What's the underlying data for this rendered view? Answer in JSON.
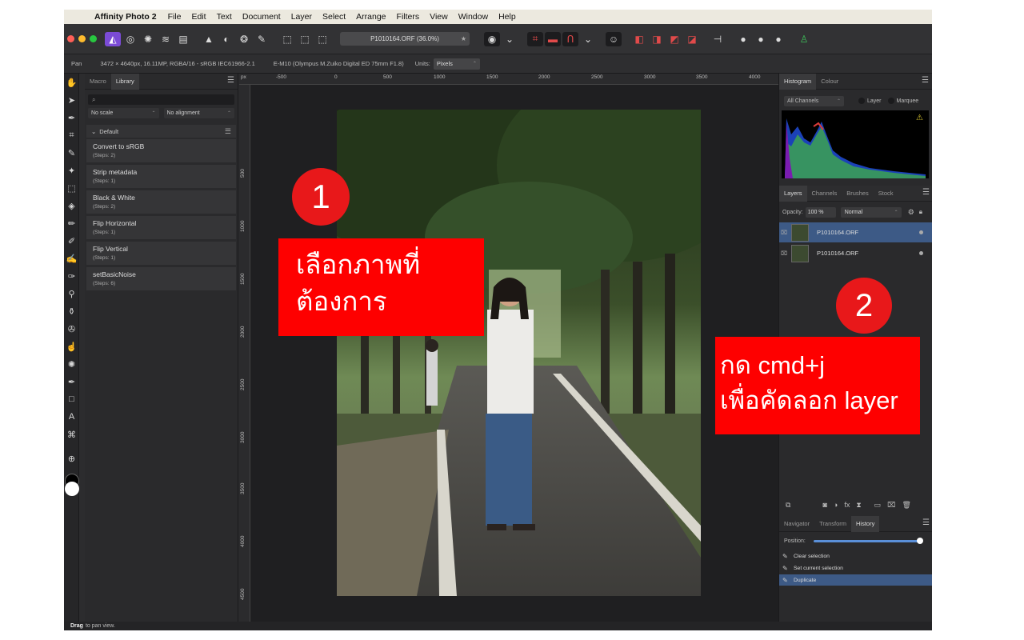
{
  "menubar": {
    "app_name": "Affinity Photo 2",
    "items": [
      "File",
      "Edit",
      "Text",
      "Document",
      "Layer",
      "Select",
      "Arrange",
      "Filters",
      "View",
      "Window",
      "Help"
    ]
  },
  "toolbar": {
    "document_title": "P1010164.ORF (36.0%)"
  },
  "context_bar": {
    "tool": "Pan",
    "image_info": "3472 × 4640px, 16.11MP, RGBA/16 - sRGB IEC61966-2.1",
    "lens_info": "E-M10 (Olympus M.Zuiko Digital ED 75mm F1.8)",
    "units_label": "Units:",
    "units_value": "Pixels"
  },
  "library_panel": {
    "tabs": [
      "Macro",
      "Library"
    ],
    "active_tab": "Library",
    "scale_select": "No scale",
    "alignment_select": "No alignment",
    "group_name": "Default",
    "macros": [
      {
        "name": "Convert to sRGB",
        "steps": "(Steps: 2)"
      },
      {
        "name": "Strip metadata",
        "steps": "(Steps: 1)"
      },
      {
        "name": "Black & White",
        "steps": "(Steps: 2)"
      },
      {
        "name": "Flip Horizontal",
        "steps": "(Steps: 1)"
      },
      {
        "name": "Flip Vertical",
        "steps": "(Steps: 1)"
      },
      {
        "name": "setBasicNoise",
        "steps": "(Steps: 6)"
      }
    ]
  },
  "rulers": {
    "unit": "px",
    "horizontal": [
      "-500",
      "0",
      "500",
      "1000",
      "1500",
      "2000",
      "2500",
      "3000",
      "3500",
      "4000"
    ],
    "vertical": [
      "500",
      "1000",
      "1500",
      "2000",
      "2500",
      "3000",
      "3500",
      "4000",
      "4500"
    ]
  },
  "histogram_panel": {
    "tabs": [
      "Histogram",
      "Colour"
    ],
    "channel_select": "All Channels",
    "option_layer": "Layer",
    "option_marquee": "Marquee"
  },
  "layers_panel": {
    "tabs": [
      "Layers",
      "Channels",
      "Brushes",
      "Stock"
    ],
    "opacity_label": "Opacity:",
    "opacity_value": "100 %",
    "blend_mode": "Normal",
    "layers": [
      {
        "name": "P1010164.ORF",
        "selected": true
      },
      {
        "name": "P1010164.ORF",
        "selected": false
      }
    ]
  },
  "history_panel": {
    "tabs": [
      "Navigator",
      "Transform",
      "History"
    ],
    "position_label": "Position:",
    "position_fraction": 1.0,
    "items": [
      {
        "label": "Clear selection",
        "selected": false
      },
      {
        "label": "Set current selection",
        "selected": false
      },
      {
        "label": "Duplicate",
        "selected": true
      }
    ]
  },
  "status_bar": {
    "bold": "Drag",
    "text": "to pan view."
  },
  "annotations": {
    "step1_number": "1",
    "step1_text_line1": "เลือกภาพที่",
    "step1_text_line2": "ต้องการ",
    "step2_number": "2",
    "step2_text_line1": "กด cmd+j",
    "step2_text_line2": "เพื่อคัดลอก layer",
    "note_color": "#fe0000",
    "badge_color": "#e8181a"
  },
  "colors": {
    "app_background": "#2c2c2e",
    "selection_blue": "#3d5a86",
    "accent_purple": "#7b4bd6"
  }
}
